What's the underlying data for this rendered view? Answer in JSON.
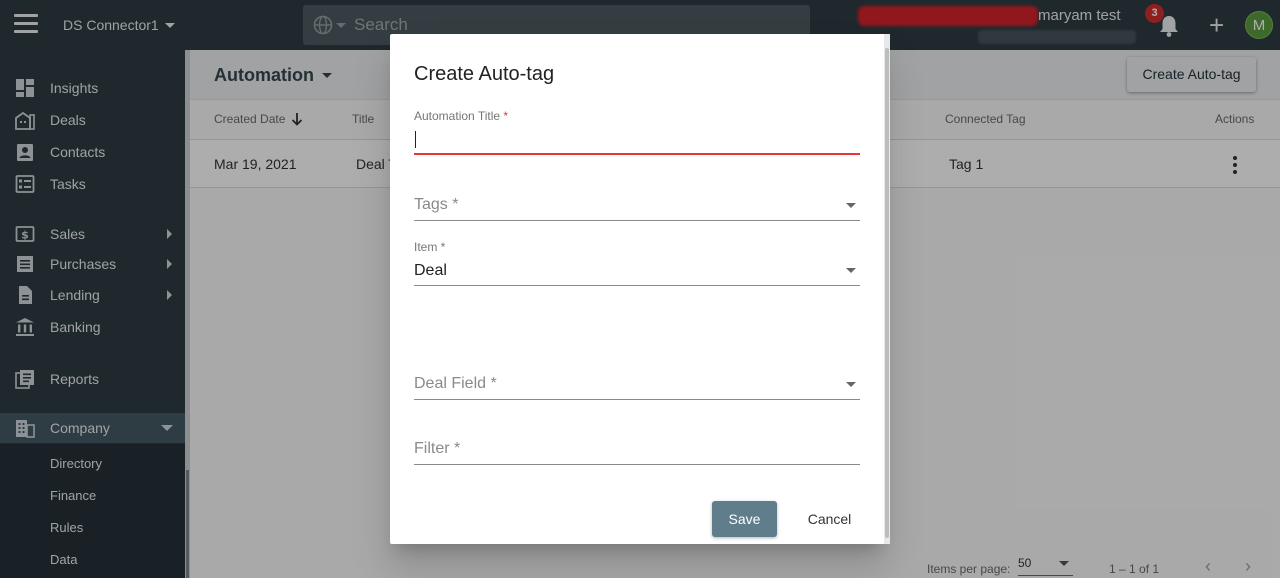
{
  "topbar": {
    "workspace": "DS Connector1",
    "search_placeholder": "Search",
    "username": "maryam test",
    "notification_count": "3",
    "avatar_initial": "M"
  },
  "sidebar": {
    "items": [
      {
        "label": "Insights",
        "icon": "dashboard-icon"
      },
      {
        "label": "Deals",
        "icon": "building-icon"
      },
      {
        "label": "Contacts",
        "icon": "contacts-icon"
      },
      {
        "label": "Tasks",
        "icon": "tasks-icon"
      },
      {
        "label": "Sales",
        "icon": "dollar-icon"
      },
      {
        "label": "Purchases",
        "icon": "list-icon"
      },
      {
        "label": "Lending",
        "icon": "document-icon"
      },
      {
        "label": "Banking",
        "icon": "bank-icon"
      },
      {
        "label": "Reports",
        "icon": "reports-icon"
      },
      {
        "label": "Company",
        "icon": "company-icon"
      }
    ],
    "company_sub_items": [
      "Directory",
      "Finance",
      "Rules",
      "Data"
    ]
  },
  "page": {
    "title": "Automation",
    "create_button": "Create Auto-tag",
    "columns": [
      "Created Date",
      "Title",
      "Connected Tag",
      "Actions"
    ],
    "rows": [
      {
        "created_date": "Mar 19, 2021",
        "title": "Deal T",
        "connected_tag": "Tag 1"
      }
    ],
    "pager": {
      "items_per_page_label": "Items per page:",
      "items_per_page": "50",
      "range": "1 – 1 of 1"
    }
  },
  "dialog": {
    "title": "Create Auto-tag",
    "automation_title_label": "Automation Title",
    "required_mark": "*",
    "tags_placeholder": "Tags *",
    "item_label": "Item *",
    "item_value": "Deal",
    "deal_field_placeholder": "Deal Field *",
    "filter_placeholder": "Filter *",
    "save_label": "Save",
    "cancel_label": "Cancel"
  },
  "colors": {
    "topbar": "#2e3c43",
    "primary_button": "#607d8b",
    "error": "#e53935",
    "badge": "#d32f2f",
    "avatar": "#5a9c3f"
  }
}
